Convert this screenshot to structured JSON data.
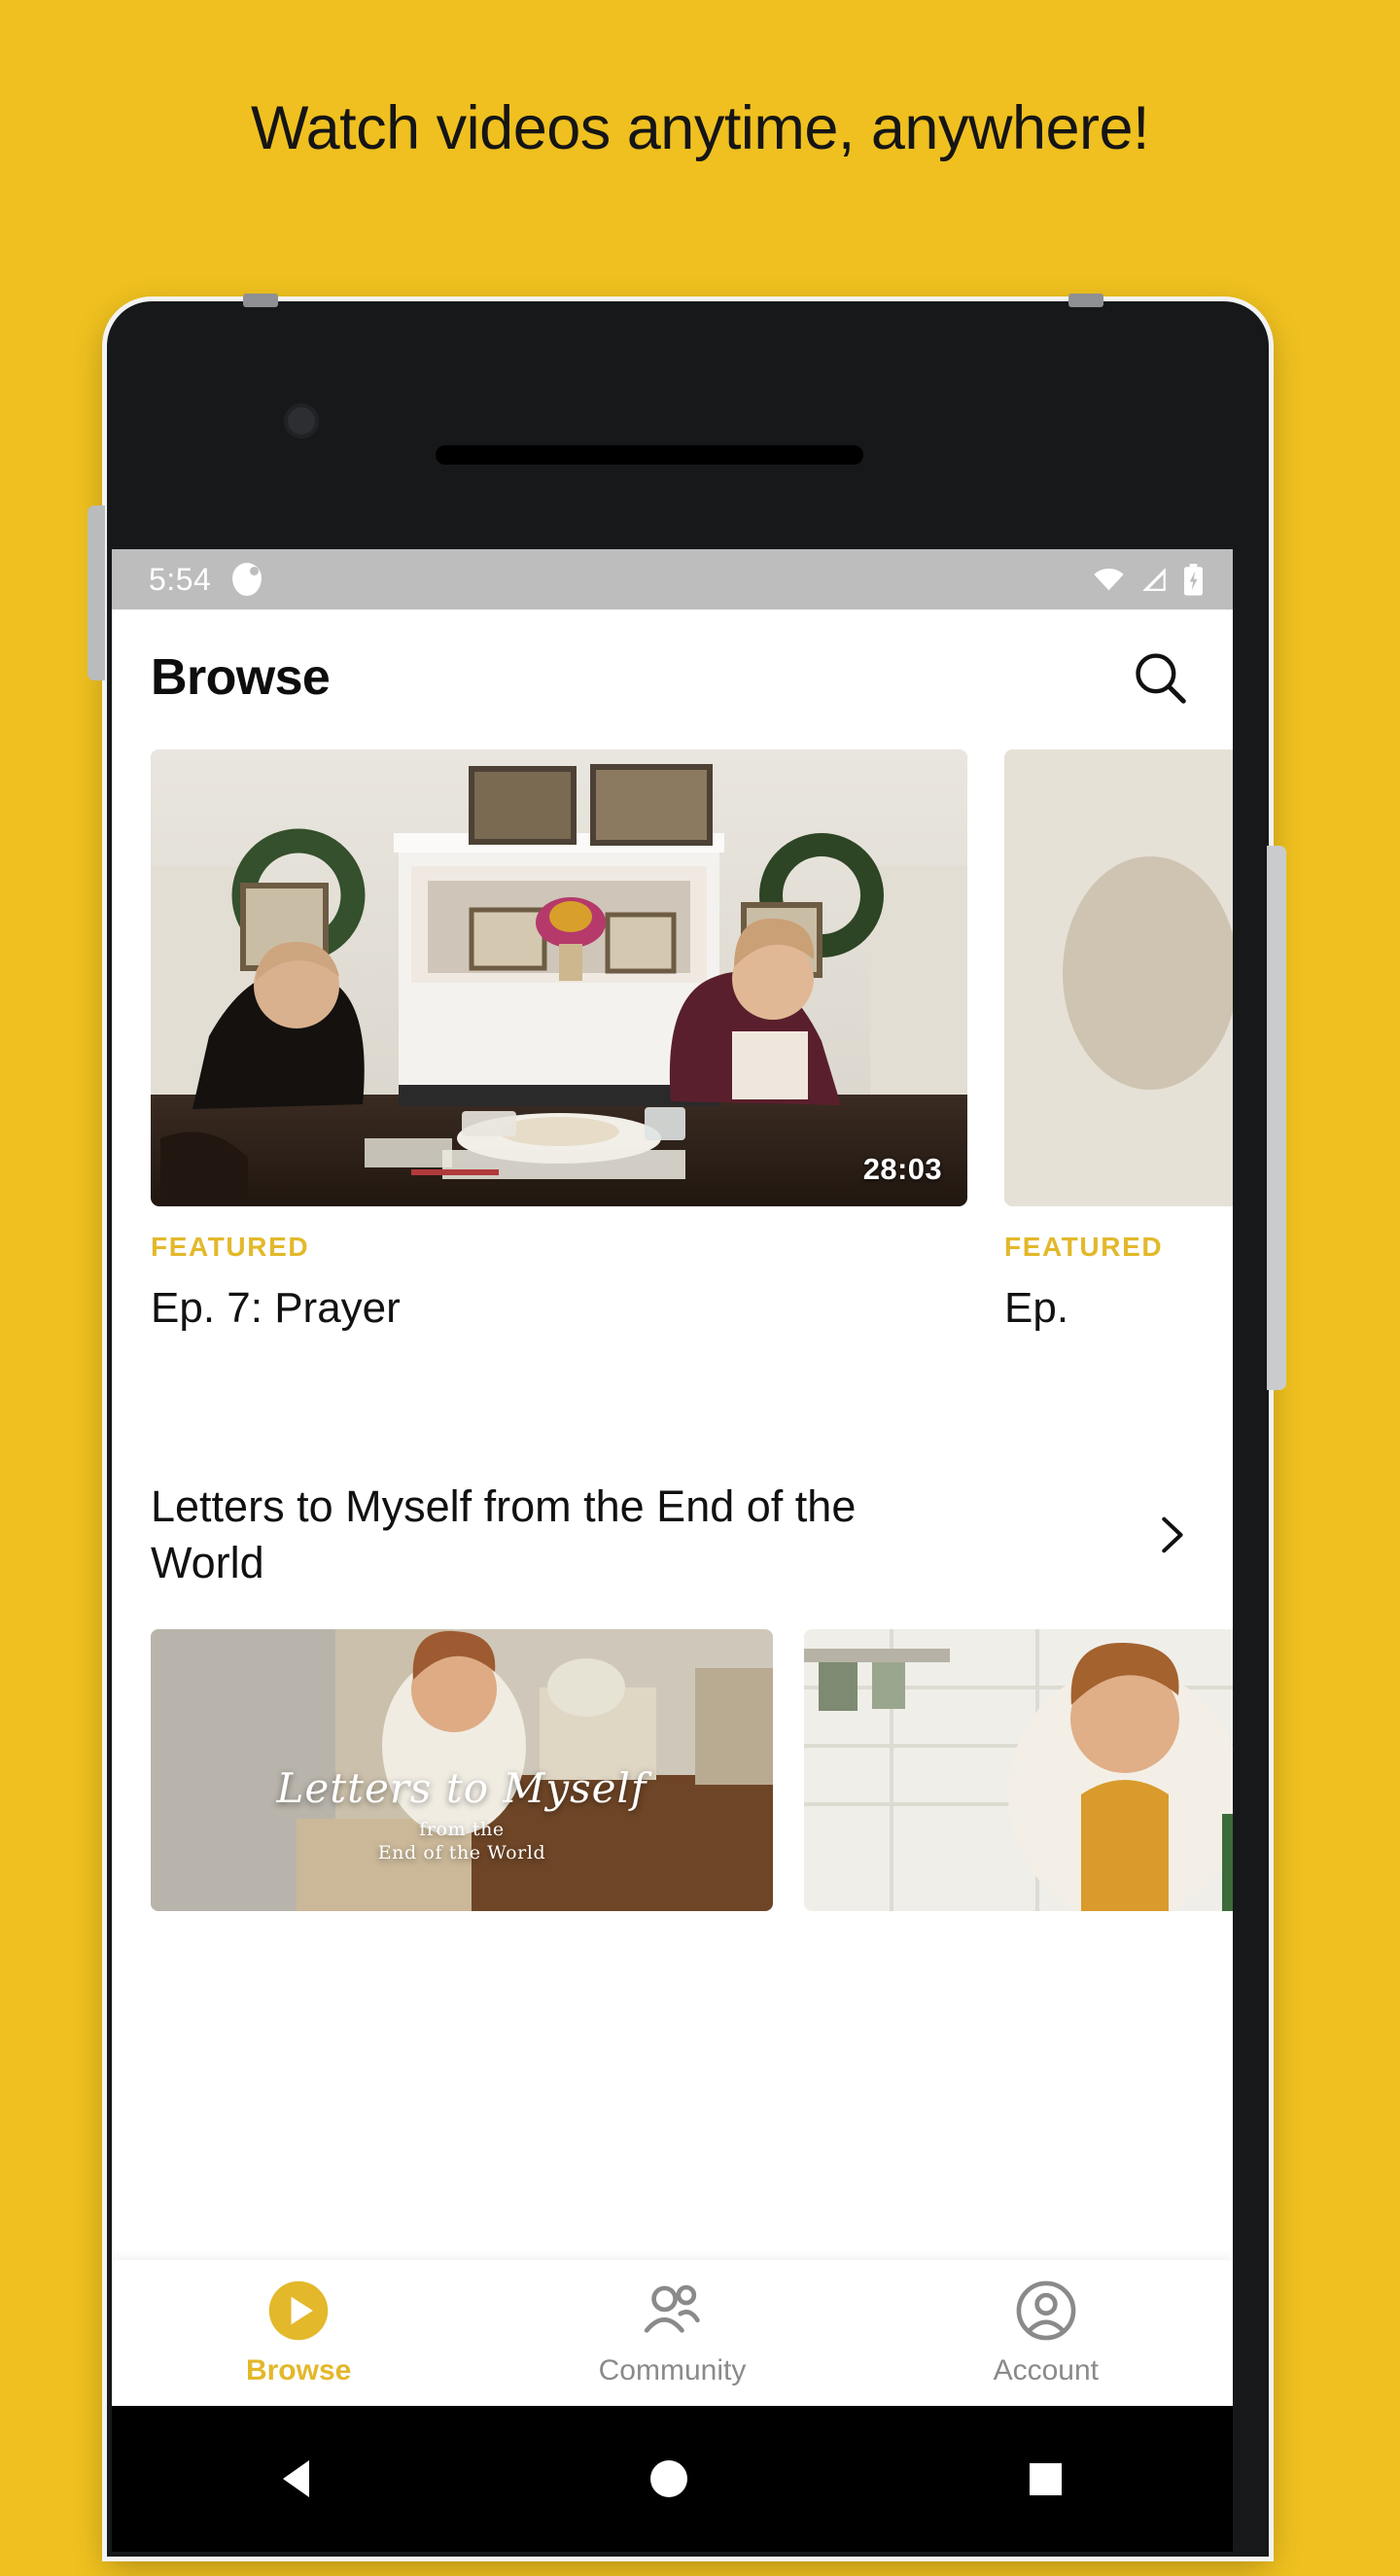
{
  "promo": {
    "headline": "Watch videos anytime, anywhere!",
    "background_color": "#EFC01F"
  },
  "status_bar": {
    "time": "5:54",
    "notification_icon": "app-notification-icon",
    "wifi_icon": "wifi-icon",
    "signal_icon": "cellular-signal-icon",
    "battery_icon": "battery-charging-icon"
  },
  "header": {
    "title": "Browse",
    "search_icon": "search-icon"
  },
  "featured": {
    "cards": [
      {
        "kicker": "FEATURED",
        "title": "Ep. 7: Prayer",
        "duration": "28:03"
      },
      {
        "kicker": "FEATURED",
        "title": "Ep."
      }
    ]
  },
  "section": {
    "title": "Letters to Myself from the End of the World",
    "chevron_icon": "chevron-right-icon",
    "thumbnails": [
      {
        "overlay_line1": "Letters to Myself",
        "overlay_line2": "from the",
        "overlay_line3": "End of the World"
      },
      {
        "overlay_line1": "",
        "overlay_line2": "",
        "overlay_line3": ""
      }
    ]
  },
  "bottom_nav": {
    "items": [
      {
        "label": "Browse",
        "icon": "play-circle-icon",
        "active": true
      },
      {
        "label": "Community",
        "icon": "people-icon",
        "active": false
      },
      {
        "label": "Account",
        "icon": "account-circle-icon",
        "active": false
      }
    ],
    "active_color": "#E3B82A",
    "inactive_color": "#8a8a8a"
  },
  "android_nav": {
    "back_icon": "back-triangle-icon",
    "home_icon": "home-circle-icon",
    "recents_icon": "recents-square-icon"
  }
}
